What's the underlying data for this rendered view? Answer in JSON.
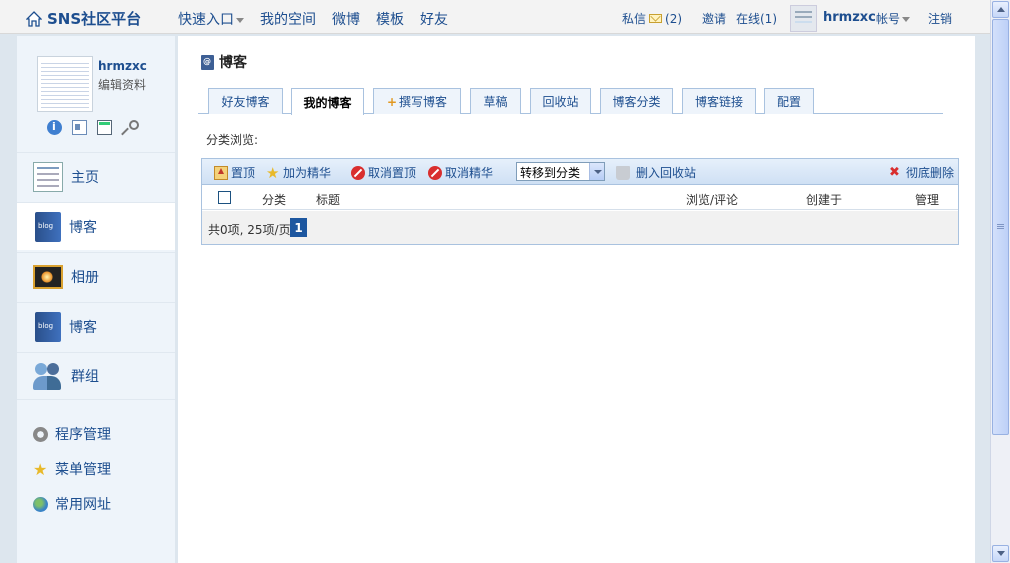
{
  "topbar": {
    "brand": "SNS社区平台",
    "nav": [
      "快速入口",
      "我的空间",
      "微博",
      "模板",
      "好友"
    ],
    "messages_label": "私信",
    "messages_count": "(2)",
    "invite": "邀请",
    "online": "在线(1)",
    "username": "hrmzxc",
    "account": "帐号",
    "logout": "注销"
  },
  "profile": {
    "name": "hrmzxc",
    "edit": "编辑资料"
  },
  "sidebar": {
    "items": [
      {
        "label": "主页"
      },
      {
        "label": "博客"
      },
      {
        "label": "相册"
      },
      {
        "label": "博客"
      },
      {
        "label": "群组"
      }
    ],
    "tools": [
      {
        "label": "程序管理"
      },
      {
        "label": "菜单管理"
      },
      {
        "label": "常用网址"
      }
    ]
  },
  "page": {
    "title": "博客",
    "tabs": [
      "好友博客",
      "我的博客",
      "撰写博客",
      "草稿",
      "回收站",
      "博客分类",
      "博客链接",
      "配置"
    ],
    "active_tab": "我的博客",
    "category_browse": "分类浏览:"
  },
  "toolbar": {
    "pin": "置顶",
    "feature": "加为精华",
    "unpin": "取消置顶",
    "unfeature": "取消精华",
    "move_select": "转移到分类",
    "to_recycle": "删入回收站",
    "delete_forever": "彻底删除"
  },
  "table": {
    "columns": [
      "分类",
      "标题",
      "浏览/评论",
      "创建于",
      "管理"
    ]
  },
  "pager": {
    "summary": "共0项, 25项/页",
    "current_page": "1"
  }
}
